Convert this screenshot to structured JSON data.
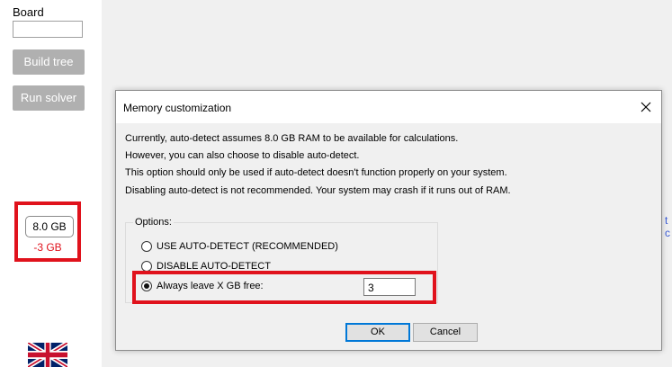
{
  "left_panel": {
    "board_label": "Board",
    "board_value": "",
    "build_tree_label": "Build tree",
    "run_solver_label": "Run solver",
    "ram_value": "8.0 GB",
    "ram_free": "-3 GB"
  },
  "right_fragment": "t c",
  "dialog": {
    "title": "Memory customization",
    "messages": [
      "Currently, auto-detect assumes 8.0 GB RAM to be available for calculations.",
      "However, you can also choose to disable auto-detect.",
      "This option should only be used if auto-detect doesn't function properly on your system.",
      "Disabling auto-detect is not recommended. Your system may crash if it runs out of RAM."
    ],
    "options_label": "Options:",
    "options": [
      {
        "label": "USE AUTO-DETECT (RECOMMENDED)",
        "checked": false
      },
      {
        "label": "DISABLE AUTO-DETECT",
        "checked": false
      },
      {
        "label": "Always leave X GB free:",
        "checked": true
      }
    ],
    "gb_free_value": "3",
    "ok_label": "OK",
    "cancel_label": "Cancel"
  },
  "colors": {
    "highlight": "#e0121c",
    "focus_border": "#0078d7",
    "disabled_button": "#b0b0b0"
  },
  "icons": {
    "close": "close-icon",
    "flag": "uk-flag-icon"
  }
}
